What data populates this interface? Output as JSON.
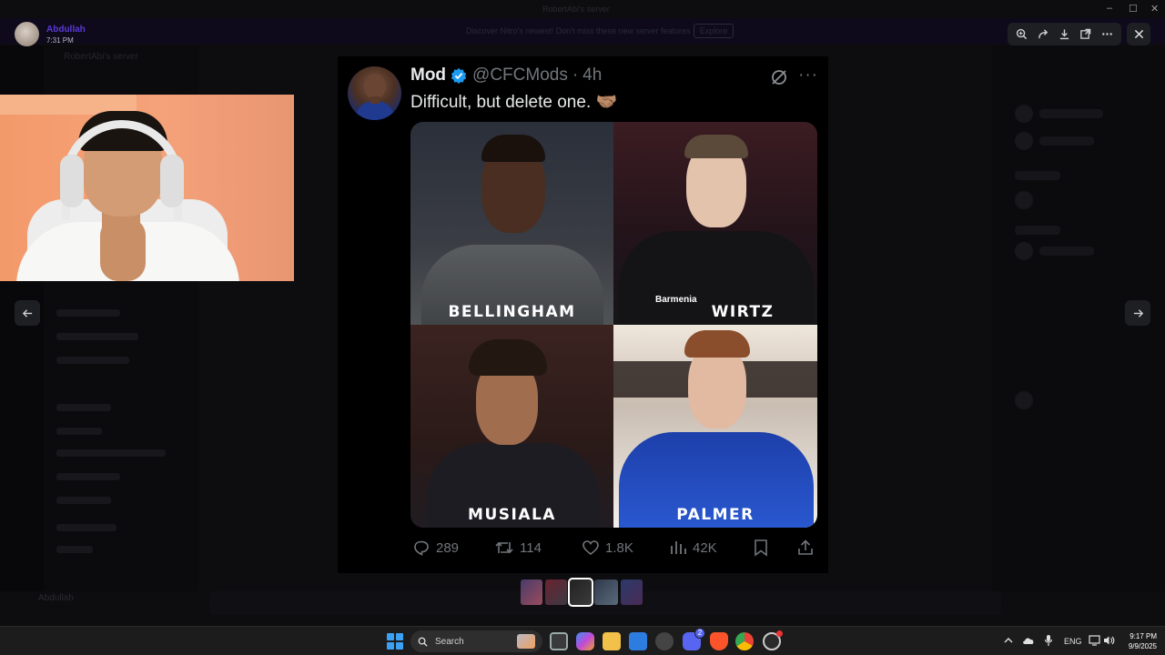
{
  "window": {
    "title": "RobertAbi's server",
    "minimize": "–",
    "maximize": "☐",
    "close": "✕"
  },
  "background": {
    "banner_text": "Discover Nitro's newest! Don't miss these new server features",
    "banner_button": "Explore",
    "server_name": "RobertAbi's server",
    "user_name": "Abdullah"
  },
  "viewer": {
    "user_name": "Abdullah",
    "timestamp": "7:31 PM",
    "toolbar_icons": [
      "zoom-icon",
      "forward-icon",
      "download-icon",
      "open-external-icon",
      "more-icon"
    ]
  },
  "tweet": {
    "display_name": "Mod",
    "handle": "@CFCMods",
    "separator": "·",
    "time": "4h",
    "text": "Difficult, but delete one. 🤝🏽",
    "more": "···",
    "players": [
      {
        "name": "BELLINGHAM"
      },
      {
        "name": "WIRTZ"
      },
      {
        "name": "MUSIALA"
      },
      {
        "name": "PALMER"
      }
    ],
    "sponsor_text": "Barmenia",
    "actions": {
      "replies": "289",
      "reposts": "114",
      "likes": "1.8K",
      "views": "42K"
    },
    "colors": {
      "verified": "#1d9bf0",
      "muted": "#71767b"
    }
  },
  "taskbar": {
    "search_label": "Search",
    "language": "ENG",
    "time": "9:17 PM",
    "date": "9/9/2025",
    "discord_badge": "2"
  }
}
